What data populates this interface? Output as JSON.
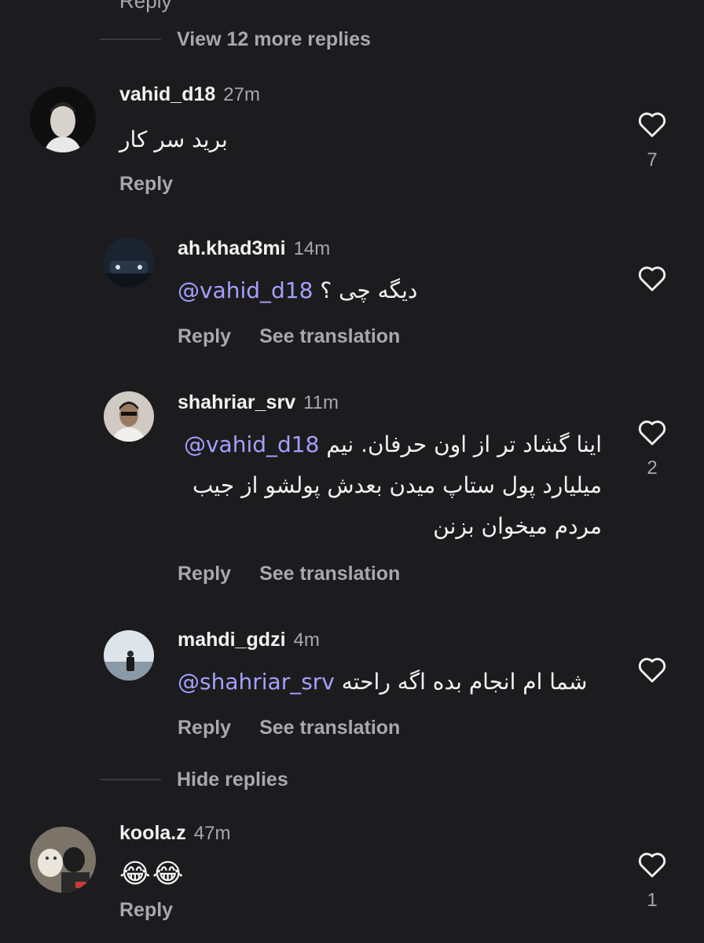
{
  "thread": {
    "top_partial": "Reply",
    "view_more": "View 12 more replies",
    "hide_replies": "Hide replies"
  },
  "labels": {
    "reply": "Reply",
    "see_translation": "See translation"
  },
  "comments": [
    {
      "username": "vahid_d18",
      "time": "27m",
      "text": "برید سر کار",
      "likes": "7"
    },
    {
      "username": "ah.khad3mi",
      "time": "14m",
      "mention": "@vahid_d18",
      "text": "دیگه چی ؟"
    },
    {
      "username": "shahriar_srv",
      "time": "11m",
      "mention": "@vahid_d18",
      "text_line1": "اینا گشاد تر از اون حرفان. نیم",
      "text_line2": "میلیارد پول ستاپ میدن بعدش پولشو از جیب",
      "text_line3": "مردم میخوان بزنن",
      "likes": "2"
    },
    {
      "username": "mahdi_gdzi",
      "time": "4m",
      "mention": "@shahriar_srv",
      "text": "شما ام انجام بده اگه راحته"
    },
    {
      "username": "koola.z",
      "time": "47m",
      "text": "😂😂",
      "likes": "1"
    }
  ],
  "colors": {
    "background": "#1c1c1e",
    "mention": "#a5a0ff",
    "muted": "#a8a8ad"
  }
}
